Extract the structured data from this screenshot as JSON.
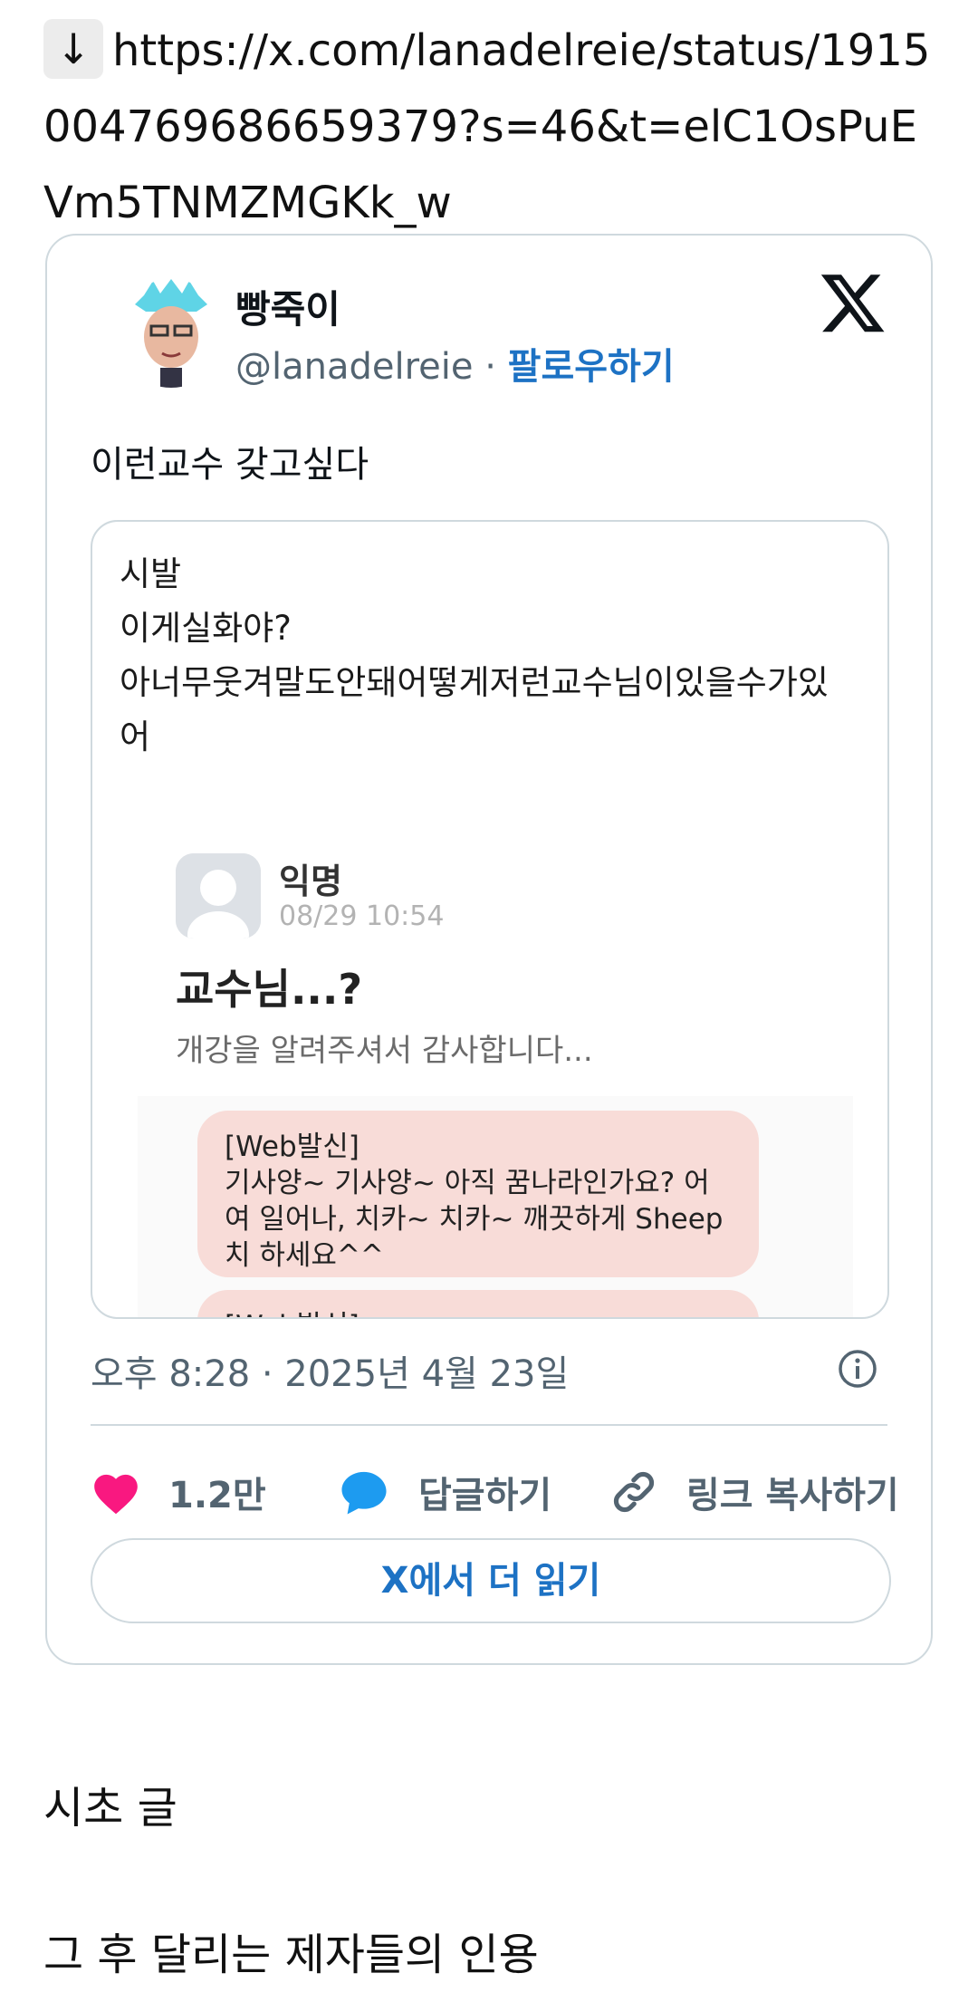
{
  "link": {
    "arrow": "↓",
    "url": "https://x.com/lanadelreie/status/1915004769686659379?s=46&t=elC1OsPuEVm5TNMZMGKk_w"
  },
  "tweet": {
    "author_name": "빵죽이",
    "handle": "@lanadelreie",
    "separator": "·",
    "follow_label": "팔로우하기",
    "text": "이런교수 갖고싶다",
    "timestamp": "오후 8:28 · 2025년 4월 23일",
    "likes": "1.2만",
    "reply_label": "답글하기",
    "copy_link_label": "링크 복사하기",
    "read_more_label": "X에서 더 읽기"
  },
  "quote": {
    "lines": [
      "시발",
      "이게실화야?",
      "아너무웃겨말도안돼어떻게저런교수님이있을수가있",
      "어"
    ],
    "post": {
      "name": "익명",
      "time": "08/29 10:54",
      "title": "교수님...?",
      "subtitle": "개강을 알려주셔서 감사합니다..."
    },
    "messages": [
      "[Web발신]\n기사양~ 기사양~ 아직 꿈나라인가요? 어여 일어나, 치카~ 치카~ 깨끗하게 Sheep치 하세요^^",
      "[Web발신]"
    ]
  },
  "body": {
    "paragraph1": "시초 글",
    "paragraph2": "그 후 달리는 제자들의 인용"
  },
  "colors": {
    "link_blue": "#1d72c4",
    "like_pink": "#f91880",
    "reply_blue": "#1d9bf0",
    "border": "#cfd9de",
    "bubble": "#f8dcd8"
  },
  "icons": [
    "download-arrow-icon",
    "x-logo-icon",
    "info-icon",
    "heart-icon",
    "reply-bubble-icon",
    "link-icon"
  ]
}
